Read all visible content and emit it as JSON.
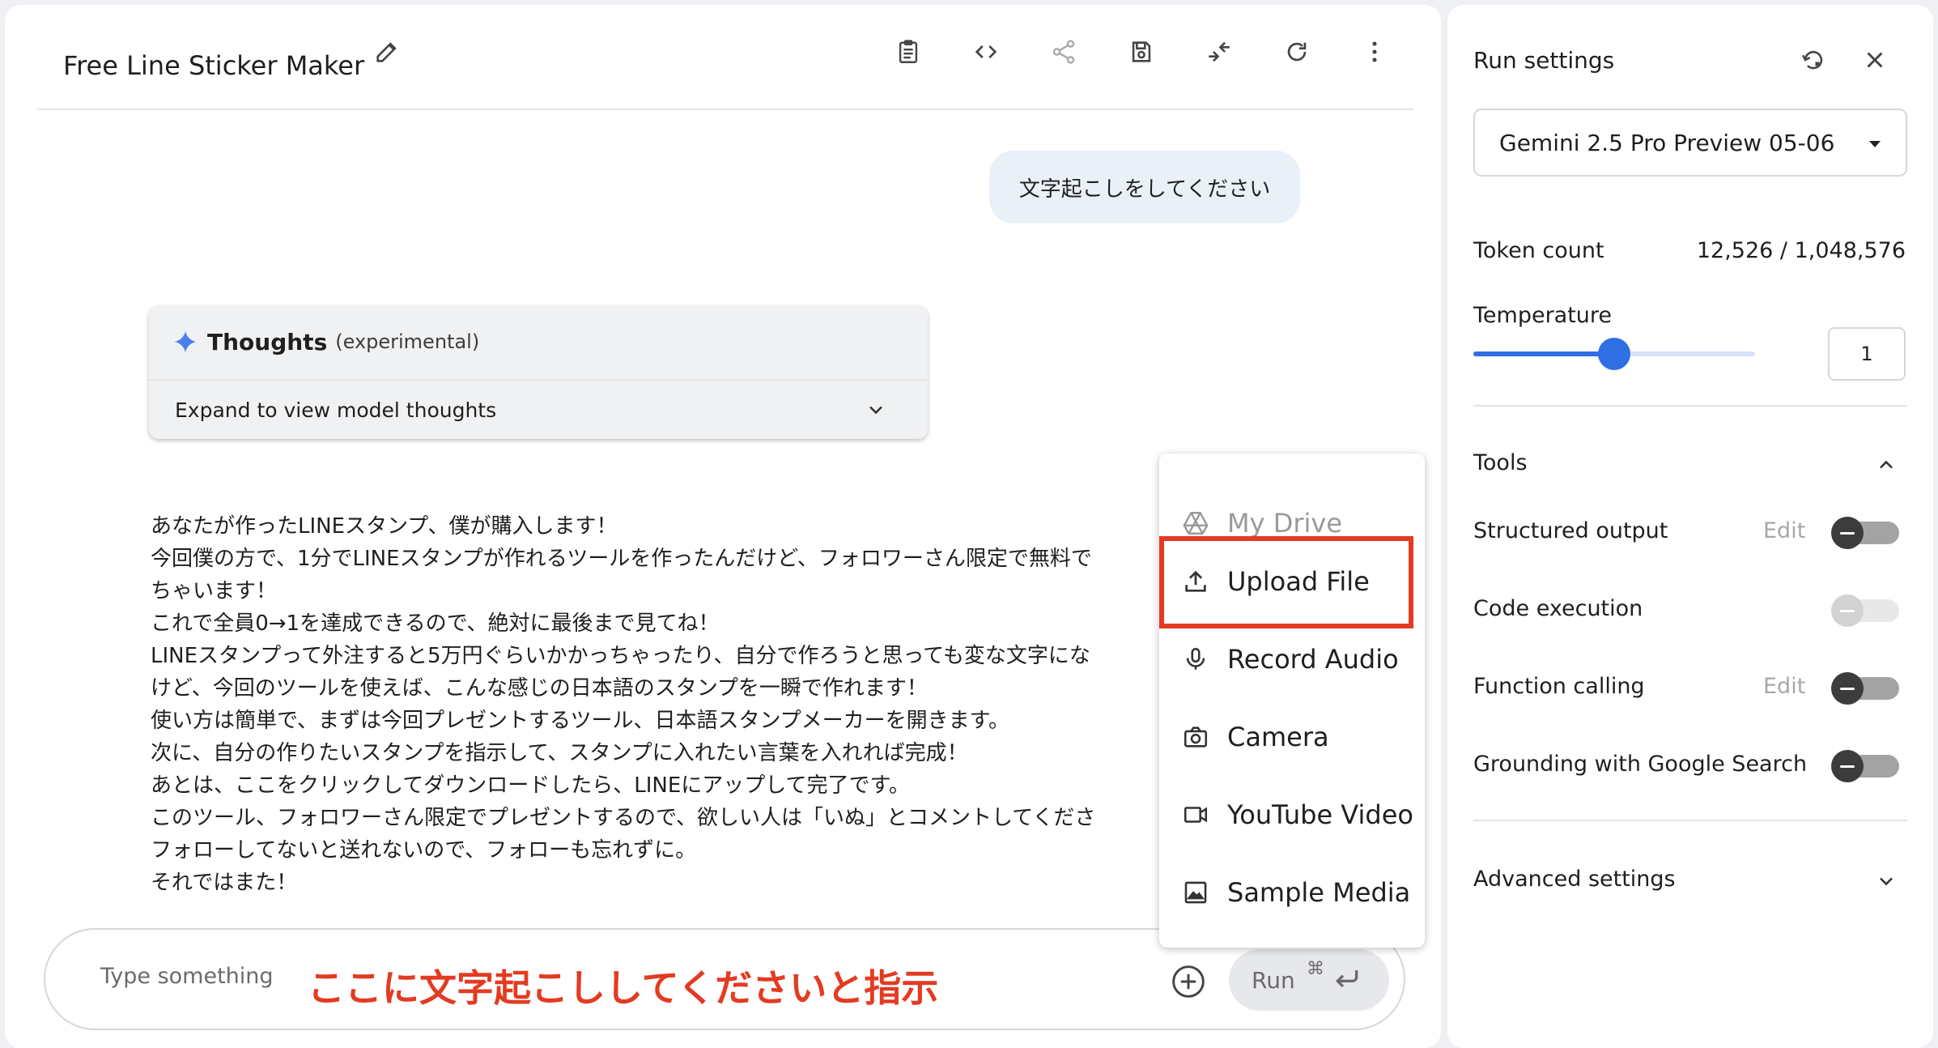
{
  "header": {
    "title": "Free Line Sticker Maker",
    "icons": [
      "edit-icon",
      "clipboard-icon",
      "code-icon",
      "share-icon",
      "save-icon",
      "compare-icon",
      "refresh-icon",
      "more-icon"
    ]
  },
  "chat": {
    "user_message": "文字起こしをしてください",
    "thoughts": {
      "label": "Thoughts",
      "sublabel": "(experimental)",
      "expand_label": "Expand to view model thoughts"
    },
    "response_lines": [
      "あなたが作ったLINEスタンプ、僕が購入します！",
      "今回僕の方で、1分でLINEスタンプが作れるツールを作ったんだけど、フォロワーさん限定で無料で",
      "ちゃいます！",
      "これで全員0→1を達成できるので、絶対に最後まで見てね！",
      "LINEスタンプって外注すると5万円ぐらいかかっちゃったり、自分で作ろうと思っても変な文字にな",
      "けど、今回のツールを使えば、こんな感じの日本語のスタンプを一瞬で作れます！",
      "使い方は簡単で、まずは今回プレゼントするツール、日本語スタンプメーカーを開きます。",
      "次に、自分の作りたいスタンプを指示して、スタンプに入れたい言葉を入れれば完成！",
      "あとは、ここをクリックしてダウンロードしたら、LINEにアップして完了です。",
      "このツール、フォロワーさん限定でプレゼントするので、欲しい人は「いぬ」とコメントしてくださ",
      "フォローしてないと送れないので、フォローも忘れずに。",
      "それではまた！"
    ]
  },
  "input": {
    "placeholder": "Type something",
    "annotation": "ここに文字起こししてくださいと指示",
    "run_label": "Run",
    "run_shortcut": "⌘"
  },
  "menu": {
    "items": [
      {
        "label": "My Drive",
        "icon": "drive-icon",
        "disabled": true
      },
      {
        "label": "Upload File",
        "icon": "upload-icon",
        "disabled": false
      },
      {
        "label": "Record Audio",
        "icon": "mic-icon",
        "disabled": false
      },
      {
        "label": "Camera",
        "icon": "camera-icon",
        "disabled": false
      },
      {
        "label": "YouTube Video",
        "icon": "video-icon",
        "disabled": false
      },
      {
        "label": "Sample Media",
        "icon": "image-icon",
        "disabled": false
      }
    ],
    "highlighted": "Upload File"
  },
  "settings": {
    "title": "Run settings",
    "model": "Gemini 2.5 Pro Preview 05-06",
    "token_count_label": "Token count",
    "token_count_value": "12,526 / 1,048,576",
    "temperature_label": "Temperature",
    "temperature_value": "1",
    "temperature_fraction": 0.5,
    "tools_label": "Tools",
    "tools": [
      {
        "label": "Structured output",
        "edit": "Edit",
        "enabled": false,
        "disabled": false
      },
      {
        "label": "Code execution",
        "edit": "",
        "enabled": false,
        "disabled": true
      },
      {
        "label": "Function calling",
        "edit": "Edit",
        "enabled": false,
        "disabled": false
      },
      {
        "label": "Grounding with Google Search",
        "edit": "",
        "enabled": false,
        "disabled": false
      }
    ],
    "advanced_label": "Advanced settings"
  },
  "colors": {
    "accent": "#2f6fe4",
    "annotation": "#e33b22",
    "bubble": "#eaf0f8"
  }
}
